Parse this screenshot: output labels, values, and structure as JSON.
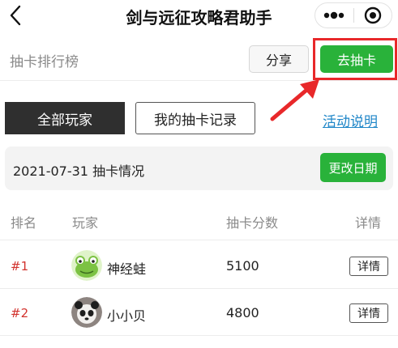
{
  "nav": {
    "title": "剑与远征攻略君助手"
  },
  "header": {
    "title": "抽卡排行榜",
    "share_label": "分享",
    "draw_label": "去抽卡"
  },
  "filters": {
    "all_players_label": "全部玩家",
    "my_records_label": "我的抽卡记录",
    "activity_link_label": "活动说明"
  },
  "date_bar": {
    "text": "2021-07-31 抽卡情况",
    "change_label": "更改日期"
  },
  "table": {
    "headers": {
      "rank": "排名",
      "player": "玩家",
      "score": "抽卡分数",
      "detail": "详情"
    },
    "rows": [
      {
        "rank": "#1",
        "name": "神经蛙",
        "score": "5100",
        "detail_label": "详情"
      },
      {
        "rank": "#2",
        "name": "小小贝",
        "score": "4800",
        "detail_label": "详情"
      }
    ]
  },
  "colors": {
    "accent_green": "#29b23a",
    "highlight_red": "#e8282a",
    "rank_red": "#d2332e",
    "link_blue": "#1f86c8",
    "dark_tab": "#2f2f2f"
  },
  "icons": {
    "back": "chevron-left-icon",
    "more": "more-dots-icon",
    "close": "target-close-icon",
    "avatar_1": "frog-avatar",
    "avatar_2": "panda-avatar"
  }
}
